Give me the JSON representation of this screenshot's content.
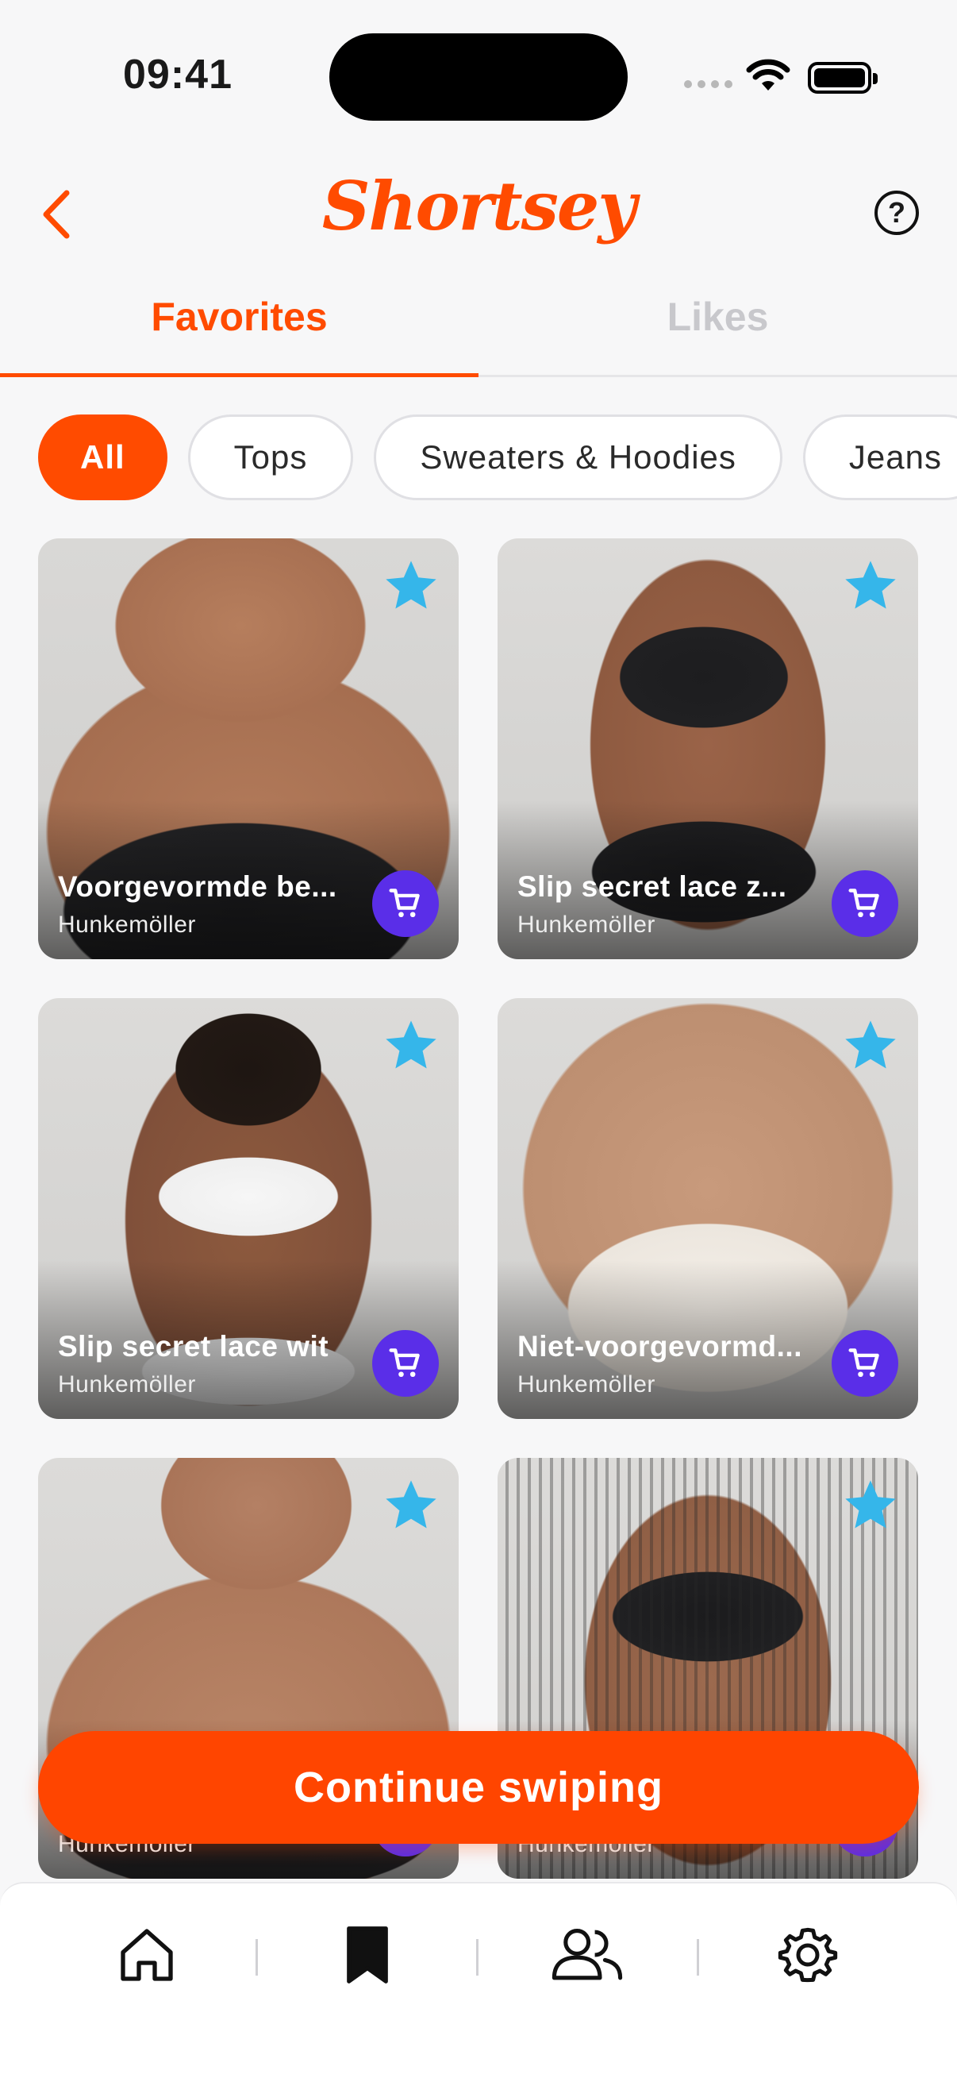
{
  "status_bar": {
    "time": "09:41"
  },
  "header": {
    "logo": "Shortsey"
  },
  "tabs": [
    {
      "label": "Favorites",
      "active": true
    },
    {
      "label": "Likes",
      "active": false
    }
  ],
  "filters": [
    {
      "label": "All",
      "active": true
    },
    {
      "label": "Tops",
      "active": false
    },
    {
      "label": "Sweaters & Hoodies",
      "active": false
    },
    {
      "label": "Jeans",
      "active": false
    }
  ],
  "products": [
    {
      "title": "Voorgevormde be...",
      "brand": "Hunkemöller"
    },
    {
      "title": "Slip secret lace z...",
      "brand": "Hunkemöller"
    },
    {
      "title": "Slip secret lace wit",
      "brand": "Hunkemöller"
    },
    {
      "title": "Niet-voorgevormd...",
      "brand": "Hunkemöller"
    },
    {
      "title": "",
      "brand": "Hunkemöller"
    },
    {
      "title": "",
      "brand": "Hunkemöller"
    }
  ],
  "cta": {
    "label": "Continue swiping"
  },
  "colors": {
    "accent": "#ff4b00",
    "cart": "#5a2ee8",
    "star": "#35b6ea"
  },
  "nav": [
    {
      "icon": "home-icon"
    },
    {
      "icon": "bookmark-icon"
    },
    {
      "icon": "people-icon"
    },
    {
      "icon": "gear-icon"
    }
  ]
}
